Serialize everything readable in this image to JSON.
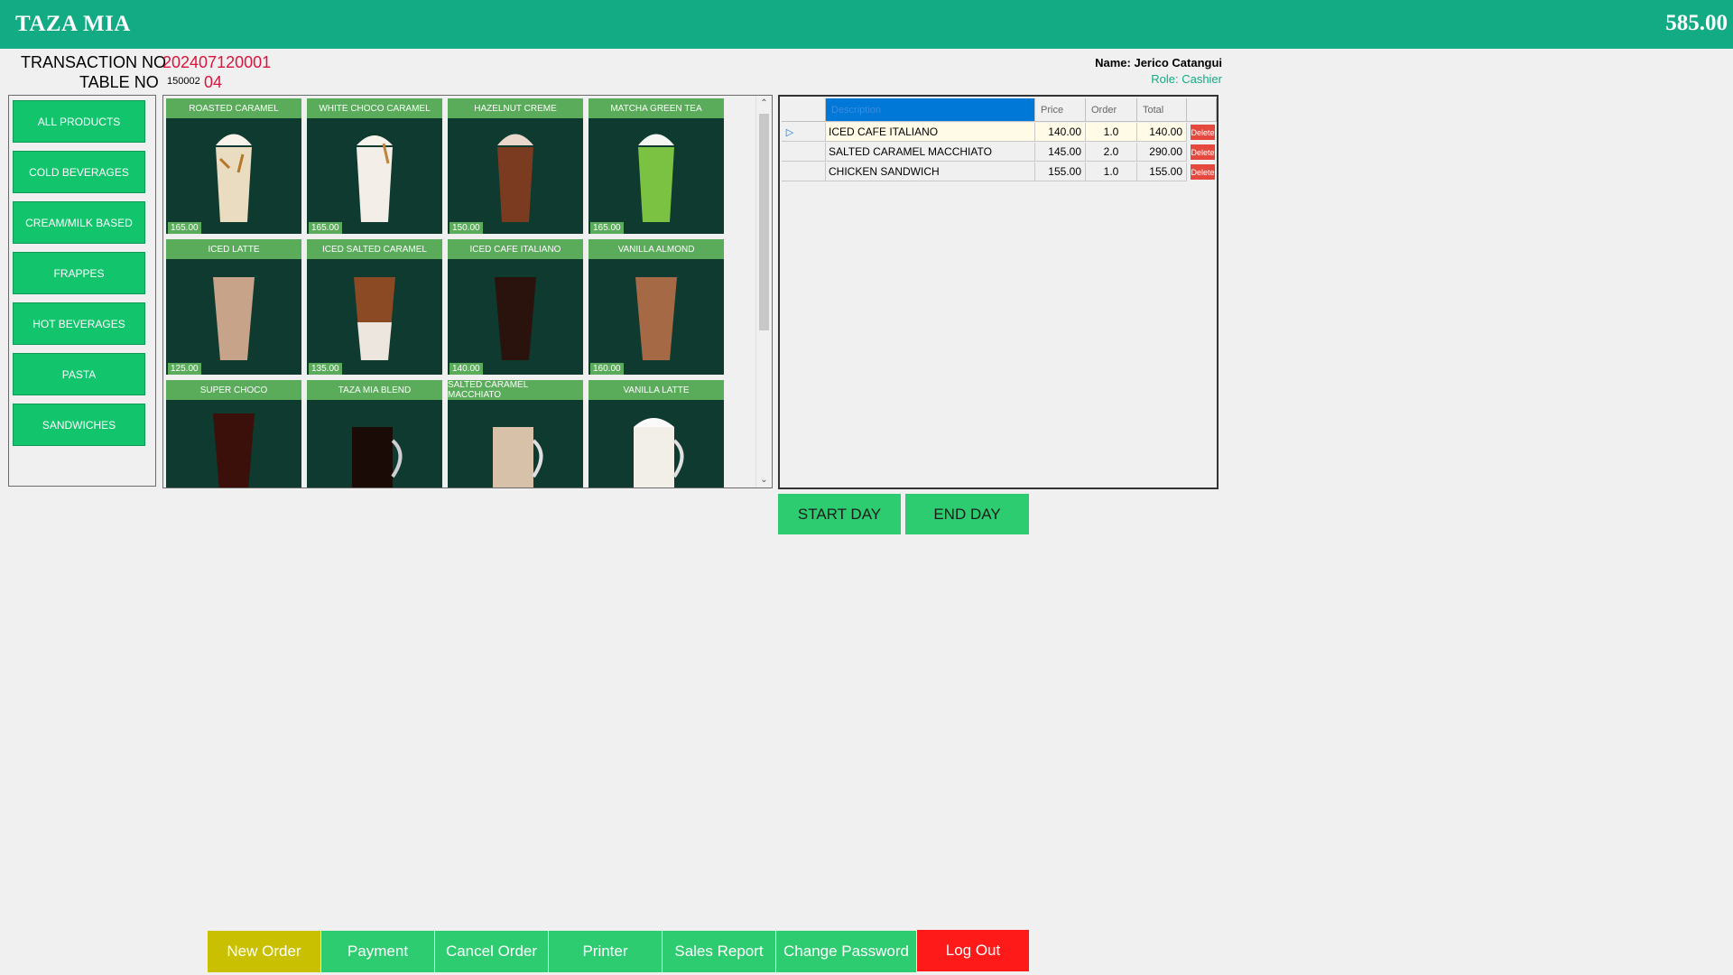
{
  "header": {
    "title": "TAZA MIA",
    "grand_total": "585.00"
  },
  "transaction": {
    "label": "TRANSACTION NO",
    "value": "202407120001"
  },
  "table": {
    "label": "TABLE NO",
    "value": "04",
    "input_value": "150002"
  },
  "user": {
    "name": "Name: Jerico Catangui",
    "role": "Role: Cashier"
  },
  "categories": [
    "ALL PRODUCTS",
    "COLD BEVERAGES",
    "CREAM/MILK BASED",
    "FRAPPES",
    "HOT BEVERAGES",
    "PASTA",
    "SANDWICHES"
  ],
  "products": [
    {
      "name": "ROASTED CARAMEL",
      "price": "165.00"
    },
    {
      "name": "WHITE CHOCO CARAMEL",
      "price": "165.00"
    },
    {
      "name": "HAZELNUT CREME",
      "price": "150.00"
    },
    {
      "name": "MATCHA GREEN TEA",
      "price": "165.00"
    },
    {
      "name": "ICED LATTE",
      "price": "125.00"
    },
    {
      "name": "ICED SALTED CARAMEL",
      "price": "135.00"
    },
    {
      "name": "ICED CAFE ITALIANO",
      "price": "140.00"
    },
    {
      "name": "VANILLA ALMOND",
      "price": "160.00"
    },
    {
      "name": "SUPER CHOCO",
      "price": ""
    },
    {
      "name": "TAZA MIA BLEND",
      "price": ""
    },
    {
      "name": "SALTED CARAMEL MACCHIATO",
      "price": ""
    },
    {
      "name": "VANILLA LATTE",
      "price": ""
    }
  ],
  "order_grid": {
    "columns": [
      "Description",
      "Price",
      "Order",
      "Total"
    ],
    "rows": [
      {
        "description": "ICED CAFE ITALIANO",
        "price": "140.00",
        "order": "1.0",
        "total": "140.00"
      },
      {
        "description": "SALTED CARAMEL MACCHIATO",
        "price": "145.00",
        "order": "2.0",
        "total": "290.00"
      },
      {
        "description": "CHICKEN SANDWICH",
        "price": "155.00",
        "order": "1.0",
        "total": "155.00"
      }
    ],
    "delete_label": "Delete"
  },
  "day_buttons": {
    "start": "START DAY",
    "end": "END DAY"
  },
  "footer": {
    "new_order": "New Order",
    "payment": "Payment",
    "cancel_order": "Cancel Order",
    "printer": "Printer",
    "sales_report": "Sales Report",
    "change_password": "Change Password",
    "log_out": "Log Out"
  },
  "colors": {
    "brand": "#12ab83",
    "button": "#2ecc71",
    "accent_red": "#dc143c",
    "new_order": "#c8c000",
    "logout": "#ff1a1a"
  }
}
